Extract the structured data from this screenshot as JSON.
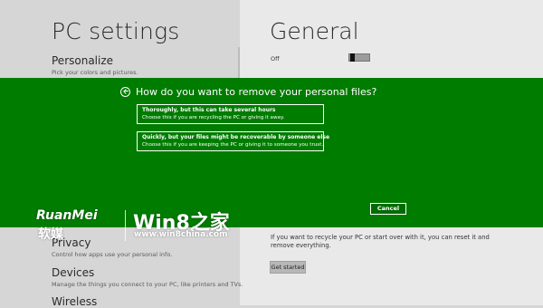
{
  "left_pane": {
    "title": "PC settings",
    "categories": [
      {
        "name": "Personalize",
        "desc": "Pick your colors and pictures."
      },
      {
        "name": "Privacy",
        "desc": "Control how apps use your personal info."
      },
      {
        "name": "Devices",
        "desc": "Manage the things you connect to your PC, like printers and TVs."
      },
      {
        "name": "Wireless",
        "desc": ""
      }
    ]
  },
  "right_pane": {
    "title": "General",
    "toggle_state": "Off",
    "reset_text": "If you want to recycle your PC or start over with it, you can reset it and remove everything.",
    "get_started_label": "Get started"
  },
  "dialog": {
    "question": "How do you want to remove your personal files?",
    "options": [
      {
        "title": "Thoroughly, but this can take several hours",
        "desc": "Choose this if you are recycling the PC or giving it away."
      },
      {
        "title": "Quickly, but your files might be recoverable by someone else",
        "desc": "Choose this if you are keeping the PC or giving it to someone you trust."
      }
    ],
    "cancel_label": "Cancel",
    "band_color": "#007c00"
  },
  "watermark": {
    "brand_en": "RuanMei",
    "brand_cn": "软媒",
    "site_title": "Win8之家",
    "site_url": "www.win8china.com"
  }
}
